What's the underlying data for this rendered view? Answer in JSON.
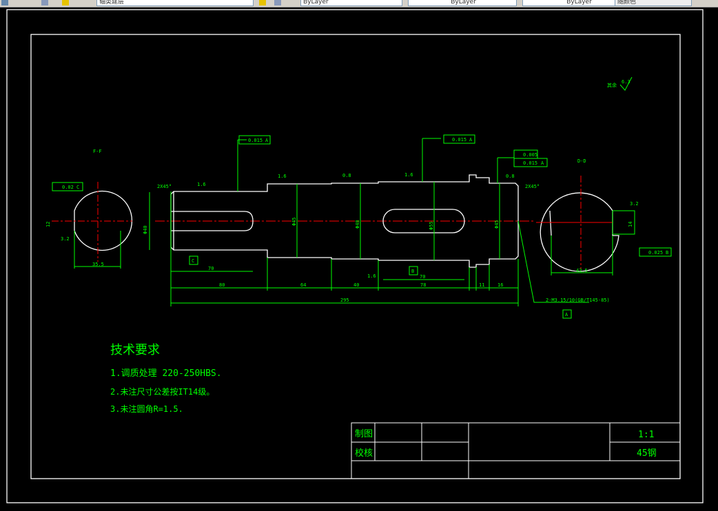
{
  "toolbar": {
    "layer_name": "轴类建层",
    "color_control": "ByLayer",
    "linetype_control": "ByLayer",
    "lineweight_control": "ByLayer",
    "plot_style": "随颜色"
  },
  "drawing": {
    "section_labels": {
      "left": "F-F",
      "right": "D-D"
    },
    "roughness_default": {
      "label": "其余",
      "value": "6.3"
    },
    "roughness_marks": [
      "1.6",
      "1.6",
      "0.8",
      "1.6",
      "0.8",
      "3.2",
      "3.2",
      "1.6"
    ],
    "chamfers": [
      "2X45°",
      "2X45°"
    ],
    "tolerance_frames": [
      {
        "symbol": "runout",
        "value": "0.015",
        "datum": "A"
      },
      {
        "symbol": "runout",
        "value": "0.015",
        "datum": "A"
      },
      {
        "symbol": "cylindricity",
        "value": "0.005",
        "datum": ""
      },
      {
        "symbol": "runout",
        "value": "0.015",
        "datum": "A"
      },
      {
        "symbol": "symmetry",
        "value": "0.02",
        "datum": "C"
      },
      {
        "symbol": "symmetry",
        "value": "0.025",
        "datum": "B"
      }
    ],
    "datums": [
      "C",
      "B",
      "A"
    ],
    "length_dims": [
      "80",
      "64",
      "40",
      "78",
      "11",
      "16"
    ],
    "keyway_dims": [
      "70",
      "70"
    ],
    "total_length": "295",
    "diameter_dims": [
      "Φ40",
      "Φ45",
      "Φ48",
      "Φ55",
      "Φ45"
    ],
    "section_dims": {
      "left_width": "35.5",
      "right_width": "42.5",
      "left_key": "12",
      "right_key": "14"
    },
    "thread_note": "2-M3.15/10(GB/T145-85)"
  },
  "tech_requirements": {
    "title": "技术要求",
    "items": [
      "1.调质处理 220-250HBS.",
      "2.未注尺寸公差按IT14级。",
      "3.未注圆角R=1.5."
    ]
  },
  "title_block": {
    "drawn_by_label": "制图",
    "checked_by_label": "校核",
    "scale": "1:1",
    "material": "45钢"
  }
}
